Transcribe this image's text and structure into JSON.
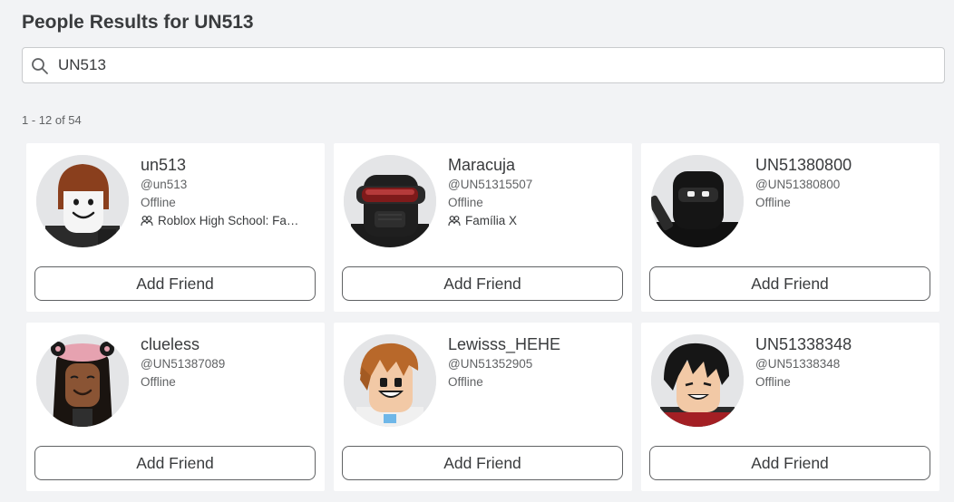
{
  "header": {
    "title_prefix": "People Results for",
    "query": "UN513"
  },
  "search": {
    "value": "UN513",
    "icon": "search-icon"
  },
  "results_count": "1 - 12 of 54",
  "cards": [
    {
      "name": "un513",
      "handle": "@un513",
      "status": "Offline",
      "group": "Roblox High School: Fa…",
      "group_icon": "group-icon",
      "button": "Add Friend"
    },
    {
      "name": "Maracuja",
      "handle": "@UN51315507",
      "status": "Offline",
      "group": "Família X",
      "group_icon": "group-icon",
      "button": "Add Friend"
    },
    {
      "name": "UN51380800",
      "handle": "@UN51380800",
      "status": "Offline",
      "button": "Add Friend"
    },
    {
      "name": "clueless",
      "handle": "@UN51387089",
      "status": "Offline",
      "button": "Add Friend"
    },
    {
      "name": "Lewisss_HEHE",
      "handle": "@UN51352905",
      "status": "Offline",
      "button": "Add Friend"
    },
    {
      "name": "UN51338348",
      "handle": "@UN51338348",
      "status": "Offline",
      "button": "Add Friend"
    }
  ]
}
